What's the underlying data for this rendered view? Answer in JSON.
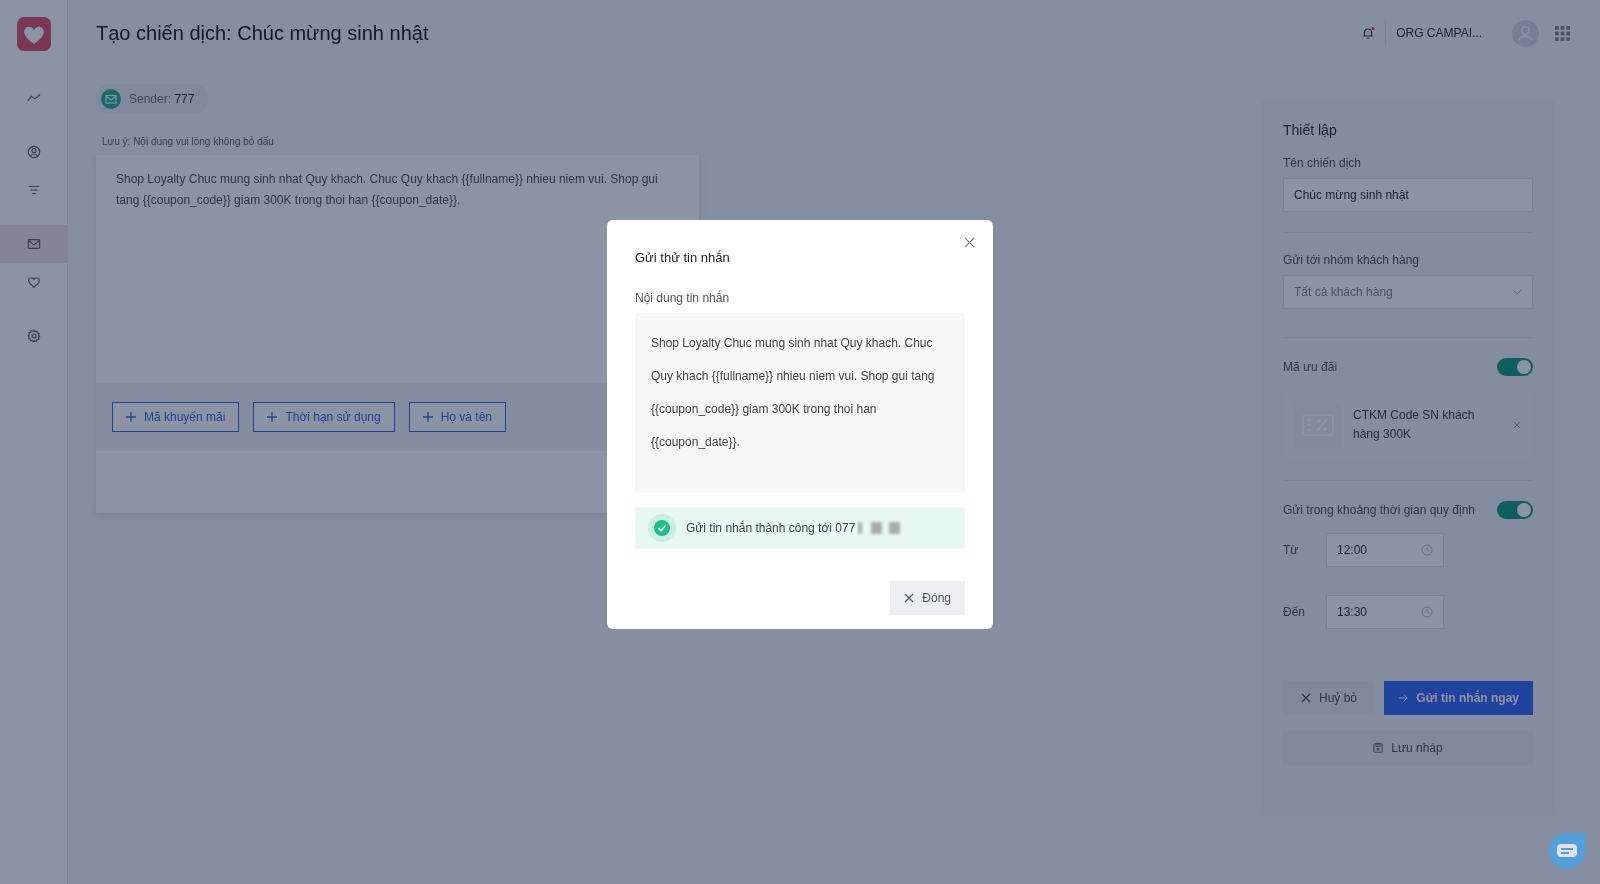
{
  "sidebar": {
    "items": [
      {
        "kind": "chart",
        "selected": false
      },
      {
        "kind": "user",
        "selected": false
      },
      {
        "kind": "filter",
        "selected": false
      },
      {
        "kind": "mail",
        "selected": true
      },
      {
        "kind": "heart",
        "selected": false
      },
      {
        "kind": "gear",
        "selected": false
      }
    ]
  },
  "header": {
    "title": "Tạo chiến dịch: Chúc mừng sinh nhật",
    "org": "ORG CAMPAI..."
  },
  "sender": {
    "label": "Sender:",
    "value": "777"
  },
  "note": "Lưu ý: Nội dung vui lòng không bỏ dấu",
  "editor": {
    "text": "Shop Loyalty Chuc mung sinh nhat Quy khach. Chuc Quy khach {{fullname}} nhieu niem vui. Shop gui tang {{coupon_code}} giam 300K trong thoi han {{coupon_date}}.",
    "buttons": [
      "Mã khuyến mãi",
      "Thời hạn sử dụng",
      "Họ và tên"
    ]
  },
  "settings": {
    "title": "Thiết lập",
    "name_label": "Tên chiến dịch",
    "name_value": "Chúc mừng sinh nhật",
    "group_label": "Gửi tới nhóm khách hàng",
    "group_value": "Tất cả khách hàng",
    "coupon_label": "Mã ưu đãi",
    "coupon_on": true,
    "coupon_name": "CTKM Code SN khách hàng 300K",
    "time_label": "Gửi trong khoảng thời gian quy định",
    "time_on": true,
    "from_label": "Từ",
    "from_value": "12:00",
    "to_label": "Đến",
    "to_value": "13:30",
    "cancel": "Huỷ bỏ",
    "send": "Gửi tin nhắn ngay",
    "draft": "Lưu nháp"
  },
  "modal": {
    "title": "Gửi thử tin nhắn",
    "content_label": "Nội dung tin nhắn",
    "content": "Shop Loyalty Chuc mung sinh nhat Quy khach. Chuc Quy khach {{fullname}} nhieu niem vui. Shop gui tang {{coupon_code}} giam 300K trong thoi han {{coupon_date}}.",
    "status": "Gửi tin nhắn thành công tới 077",
    "close": "Đóng"
  }
}
